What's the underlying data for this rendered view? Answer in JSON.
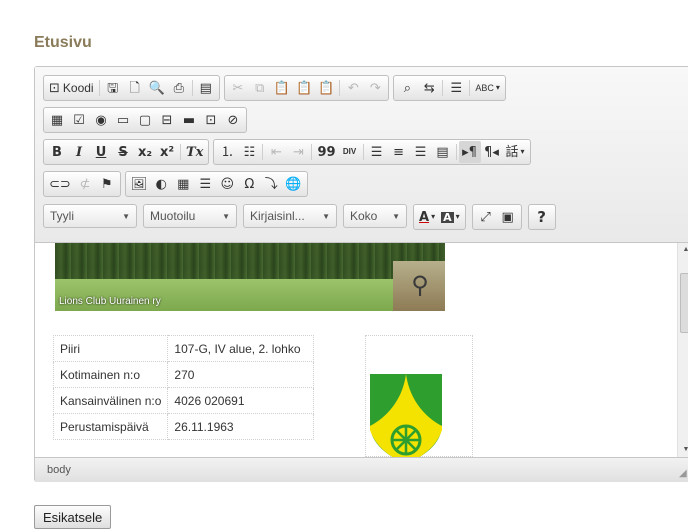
{
  "page": {
    "title": "Etusivu"
  },
  "toolbar": {
    "source_label": "Koodi",
    "styles_combo": "Tyyli",
    "format_combo": "Muotoilu",
    "font_combo": "Kirjaisinl...",
    "size_combo": "Koko",
    "text_color_glyph": "A",
    "bg_color_glyph": "A",
    "help_glyph": "?",
    "spell_glyph": "ABC",
    "bold_glyph": "B",
    "italic_glyph": "I",
    "underline_glyph": "U",
    "strike_glyph": "S",
    "sub_glyph": "x₂",
    "sup_glyph": "x²",
    "remove_format_glyph": "Tx",
    "blockquote_glyph": "99",
    "div_glyph": "DIV",
    "bidi_glyph": "話"
  },
  "content": {
    "banner_caption": "Lions Club Uurainen ry",
    "info_rows": [
      {
        "label": "Piiri",
        "value": "107-G, IV alue, 2. lohko"
      },
      {
        "label": "Kotimainen n:o",
        "value": "270"
      },
      {
        "label": "Kansainvälinen n:o",
        "value": "4026 020691"
      },
      {
        "label": "Perustamispäivä",
        "value": "26.11.1963"
      }
    ]
  },
  "statusbar": {
    "path": "body"
  },
  "actions": {
    "preview_label": "Esikatsele"
  },
  "colors": {
    "title": "#8a7c5a",
    "coa_green": "#2e9e2e",
    "coa_yellow": "#f4e200"
  }
}
